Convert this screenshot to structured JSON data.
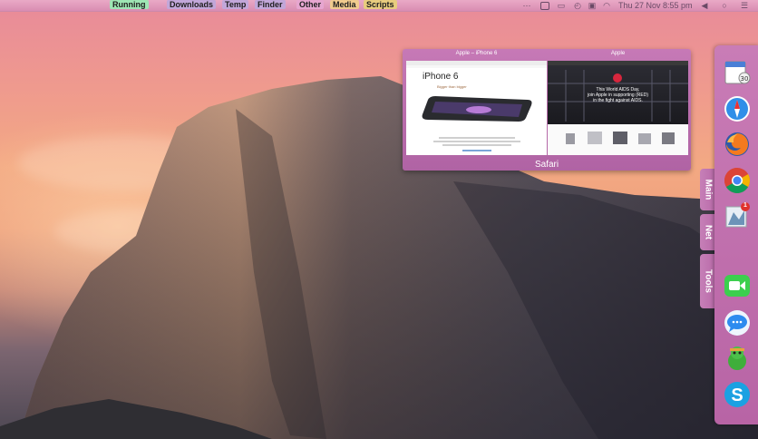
{
  "menubar": {
    "tags": [
      {
        "label": "Running",
        "color": "#9ee6b4"
      },
      {
        "label": "Downloads",
        "color": "#c2a7d9"
      },
      {
        "label": "Temp",
        "color": "#c2a7d9"
      },
      {
        "label": "Finder",
        "color": "#c2a7d9"
      },
      {
        "label": "Other",
        "color": "#e7a6d0"
      },
      {
        "label": "Media",
        "color": "#f0cb8e"
      },
      {
        "label": "Scripts",
        "color": "#e8cc7e"
      }
    ],
    "clock": "Thu 27 Nov  8:55 pm"
  },
  "preview": {
    "windows": [
      {
        "title": "Apple – iPhone 6",
        "heading": "iPhone 6",
        "subheading": "Bigger than bigger"
      },
      {
        "title": "Apple",
        "banner_line1": "This World AIDS Day,",
        "banner_line2": "join Apple in supporting (RED)",
        "banner_line3": "in the fight against AIDS."
      }
    ],
    "app_label": "Safari"
  },
  "dock": {
    "tabs": [
      "Main",
      "Net",
      "Tools"
    ],
    "apps": [
      "calendar-icon",
      "safari-icon",
      "firefox-icon",
      "chrome-icon",
      "mail-icon",
      "facetime-icon",
      "messages-icon",
      "adium-icon",
      "skype-icon"
    ],
    "mail_badge": "1"
  },
  "colors": {
    "menubar": "#e0a0c0",
    "dock": "#c07ab0",
    "preview": "#b869aa"
  }
}
